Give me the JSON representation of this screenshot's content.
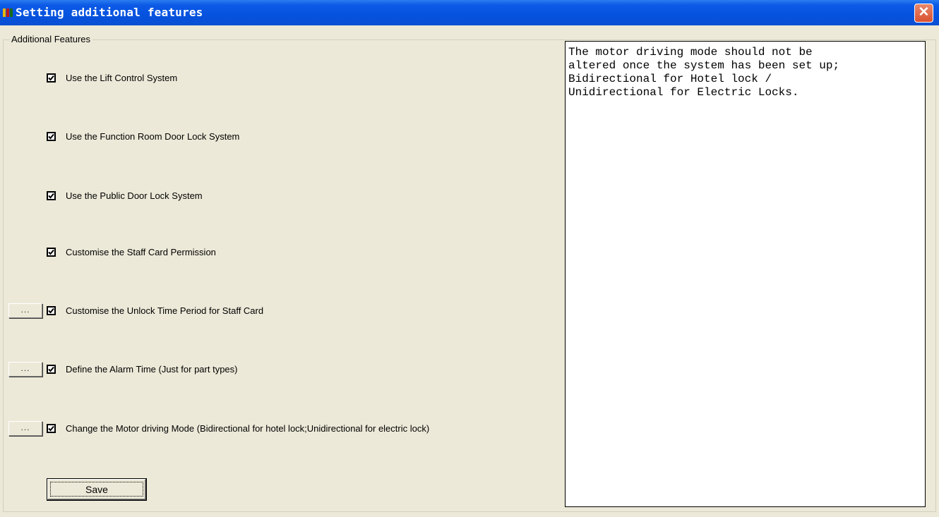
{
  "window": {
    "title": "Setting additional features",
    "app_icon": "app-icon",
    "close_icon": "close-icon",
    "close_glyph": "✕"
  },
  "group": {
    "legend": "Additional Features"
  },
  "options": [
    {
      "label": "Use the Lift Control System",
      "checked": true,
      "has_button": false
    },
    {
      "label": "Use the Function Room Door Lock System",
      "checked": true,
      "has_button": false
    },
    {
      "label": "Use the Public Door Lock System",
      "checked": true,
      "has_button": false
    },
    {
      "label": "Customise the Staff Card Permission",
      "checked": true,
      "has_button": false
    },
    {
      "label": "Customise the Unlock Time Period for Staff Card",
      "checked": true,
      "has_button": true
    },
    {
      "label": "Define the Alarm Time (Just for part types)",
      "checked": true,
      "has_button": true
    },
    {
      "label": "Change the Motor driving Mode (Bidirectional for hotel lock;Unidirectional for electric lock)",
      "checked": true,
      "has_button": true
    }
  ],
  "ellipsis_label": "...",
  "save_label": "Save",
  "info_text": "The motor driving mode should not be\naltered once the system has been set up;\nBidirectional for Hotel lock /\nUnidirectional for Electric Locks.",
  "colors": {
    "titlebar": "#0552df",
    "background": "#ece9d8",
    "close_button": "#d9512f"
  }
}
